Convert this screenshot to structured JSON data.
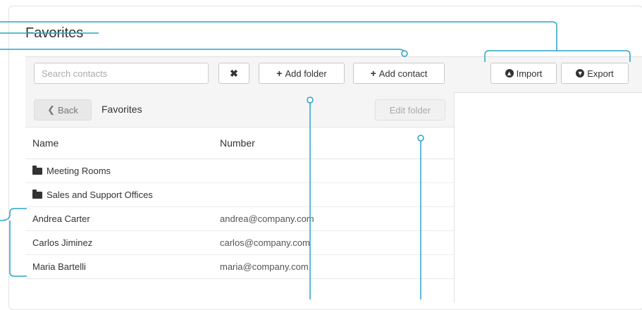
{
  "page": {
    "title": "Favorites"
  },
  "toolbar": {
    "search_placeholder": "Search contacts",
    "clear_icon": "✖",
    "add_folder_label": "Add folder",
    "add_contact_label": "Add contact",
    "import_label": "Import",
    "export_label": "Export",
    "plus_icon": "+"
  },
  "panel": {
    "back_label": "Back",
    "folder_title": "Favorites",
    "edit_folder_label": "Edit folder",
    "columns": {
      "name": "Name",
      "number": "Number"
    },
    "folders": [
      {
        "name": "Meeting Rooms"
      },
      {
        "name": "Sales and Support Offices"
      }
    ],
    "contacts": [
      {
        "name": "Andrea Carter",
        "number": "andrea@company.com"
      },
      {
        "name": "Carlos Jiminez",
        "number": "carlos@company.com"
      },
      {
        "name": "Maria Bartelli",
        "number": "maria@company.com"
      }
    ]
  },
  "colors": {
    "callout": "#29a3c9"
  }
}
